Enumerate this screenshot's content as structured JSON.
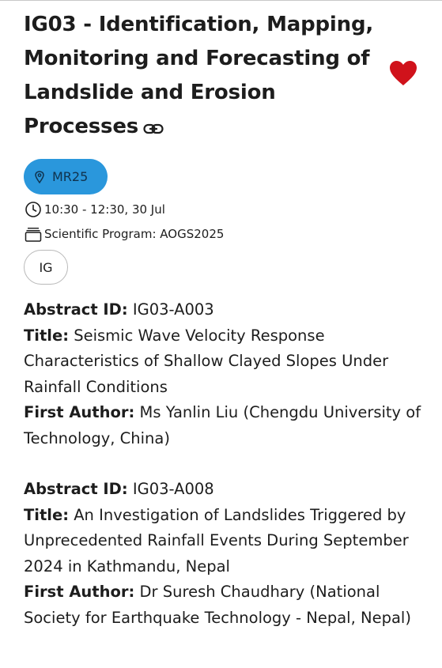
{
  "session": {
    "title": "IG03 - Identification, Mapping, Monitoring and Forecasting of Landslide and Erosion Processes",
    "link_icon": "link-icon",
    "favorite_icon": "heart-icon",
    "favorite_color": "#d0121b",
    "room": "MR25",
    "room_icon": "map-pin-icon",
    "room_color": "#2a97dc",
    "time": "10:30 - 12:30, 30 Jul",
    "time_icon": "clock-icon",
    "program": "Scientific Program: AOGS2025",
    "program_icon": "stack-icon",
    "tag": "IG"
  },
  "labels": {
    "abstract_id": "Abstract ID:",
    "title": "Title:",
    "first_author": "First Author:"
  },
  "abstracts": [
    {
      "id": "IG03-A003",
      "title": "Seismic Wave Velocity Response Characteristics of Shallow Clayed Slopes Under Rainfall Conditions",
      "author": "Ms Yanlin Liu (Chengdu University of Technology, China)"
    },
    {
      "id": "IG03-A008",
      "title": "An Investigation of Landslides Triggered by Unprecedented Rainfall Events During September 2024 in Kathmandu, Nepal",
      "author": "Dr Suresh Chaudhary (National Society for Earthquake Technology - Nepal, Nepal)"
    }
  ]
}
